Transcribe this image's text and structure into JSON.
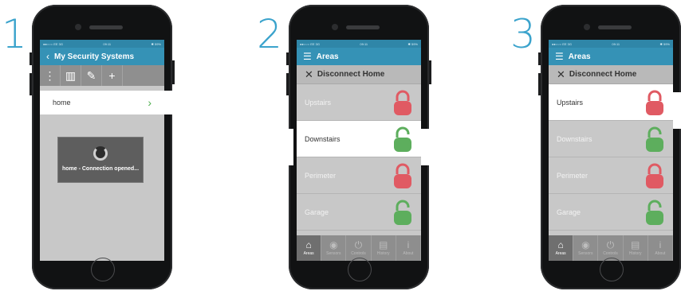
{
  "steps": [
    "1",
    "2",
    "3"
  ],
  "status": {
    "left": "●●○○○ EE  3G",
    "time1": "09:11",
    "time2": "09:11",
    "time3": "09:11",
    "right": "✱ 59%"
  },
  "screen1": {
    "title": "My Security Systems",
    "back_icon": "chevron-left-icon",
    "toolbar": [
      {
        "name": "more-icon",
        "glyph": "⋮"
      },
      {
        "name": "trash-icon",
        "glyph": "▥"
      },
      {
        "name": "edit-icon",
        "glyph": "✎"
      },
      {
        "name": "add-icon",
        "glyph": "+"
      }
    ],
    "system": "home",
    "toast": "home - Connection opened..."
  },
  "areas_title": "Areas",
  "disconnect_label": "Disconnect Home",
  "areas": [
    {
      "label": "Upstairs",
      "state": "locked"
    },
    {
      "label": "Downstairs",
      "state": "unlocked"
    },
    {
      "label": "Perimeter",
      "state": "locked"
    },
    {
      "label": "Garage",
      "state": "unlocked"
    }
  ],
  "tabs": [
    "Areas",
    "Sensors",
    "Controls",
    "History",
    "About"
  ],
  "colors": {
    "accent": "#3592b6",
    "locked": "#e05a63",
    "unlocked": "#5dae5d",
    "step_number": "#3ba3cc"
  }
}
